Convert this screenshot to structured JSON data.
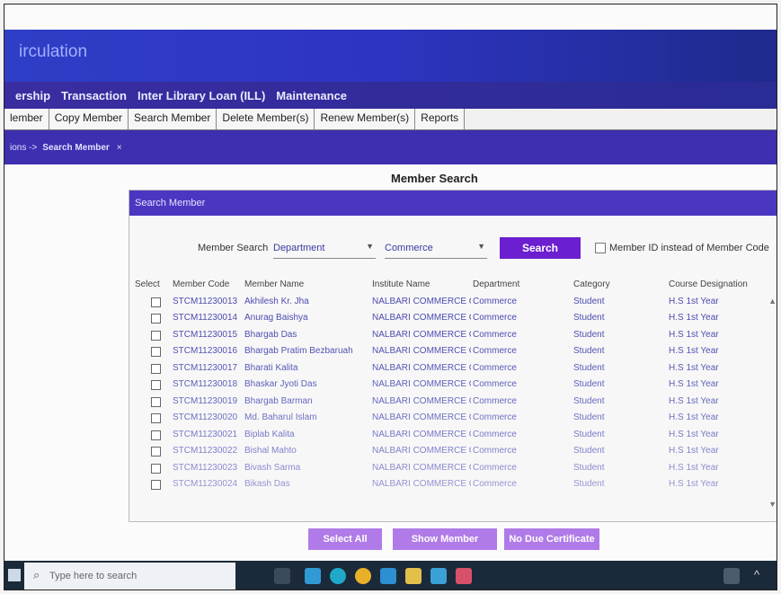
{
  "app": {
    "title": "irculation"
  },
  "menu": [
    "ership",
    "Transaction",
    "Inter Library Loan (ILL)",
    "Maintenance"
  ],
  "subtabs": [
    "lember",
    "Copy Member",
    "Search Member",
    "Delete Member(s)",
    "Renew Member(s)",
    "Reports"
  ],
  "breadcrumb": {
    "path": "ions ->",
    "current": "Search Member",
    "close": "×"
  },
  "page_title": "Member Search",
  "panel": {
    "heading": "Search Member",
    "search_label": "Member Search",
    "search_by": "Department",
    "search_value": "Commerce",
    "search_button": "Search",
    "option_label": "Member ID instead of Member Code"
  },
  "table": {
    "headers": [
      "Select",
      "Member Code",
      "Member Name",
      "Institute Name",
      "Department",
      "Category",
      "Course Designation"
    ],
    "rows": [
      {
        "code": "STCM11230013",
        "name": "Akhilesh Kr. Jha",
        "institute": "NALBARI COMMERCE C",
        "dept": "Commerce",
        "category": "Student",
        "course": "H.S 1st Year"
      },
      {
        "code": "STCM11230014",
        "name": "Anurag Baishya",
        "institute": "NALBARI COMMERCE C",
        "dept": "Commerce",
        "category": "Student",
        "course": "H.S 1st Year"
      },
      {
        "code": "STCM11230015",
        "name": "Bhargab Das",
        "institute": "NALBARI COMMERCE C",
        "dept": "Commerce",
        "category": "Student",
        "course": "H.S 1st Year"
      },
      {
        "code": "STCM11230016",
        "name": "Bhargab Pratim Bezbaruah",
        "institute": "NALBARI COMMERCE C",
        "dept": "Commerce",
        "category": "Student",
        "course": "H.S 1st Year"
      },
      {
        "code": "STCM11230017",
        "name": "Bharati Kalita",
        "institute": "NALBARI COMMERCE C",
        "dept": "Commerce",
        "category": "Student",
        "course": "H.S 1st Year"
      },
      {
        "code": "STCM11230018",
        "name": "Bhaskar Jyoti Das",
        "institute": "NALBARI COMMERCE C",
        "dept": "Commerce",
        "category": "Student",
        "course": "H.S 1st Year"
      },
      {
        "code": "STCM11230019",
        "name": "Bhargab Barman",
        "institute": "NALBARI COMMERCE C",
        "dept": "Commerce",
        "category": "Student",
        "course": "H.S 1st Year"
      },
      {
        "code": "STCM11230020",
        "name": "Md. Baharul Islam",
        "institute": "NALBARI COMMERCE C",
        "dept": "Commerce",
        "category": "Student",
        "course": "H.S 1st Year"
      },
      {
        "code": "STCM11230021",
        "name": "Biplab Kalita",
        "institute": "NALBARI COMMERCE C",
        "dept": "Commerce",
        "category": "Student",
        "course": "H.S 1st Year"
      },
      {
        "code": "STCM11230022",
        "name": "Bishal Mahto",
        "institute": "NALBARI COMMERCE C",
        "dept": "Commerce",
        "category": "Student",
        "course": "H.S 1st Year"
      },
      {
        "code": "STCM11230023",
        "name": "Bivash Sarma",
        "institute": "NALBARI COMMERCE C",
        "dept": "Commerce",
        "category": "Student",
        "course": "H.S 1st Year"
      },
      {
        "code": "STCM11230024",
        "name": "Bikash Das",
        "institute": "NALBARI COMMERCE C",
        "dept": "Commerce",
        "category": "Student",
        "course": "H.S 1st Year"
      }
    ]
  },
  "actions": {
    "select_all": "Select All",
    "show_member": "Show Member",
    "no_due": "No Due Certificate"
  },
  "taskbar": {
    "search_placeholder": "Type here to search"
  },
  "colors": {
    "header": "#2f3ec6",
    "panel_header": "#4a37c1",
    "search_button": "#6b1fd0",
    "action_button": "#b07be8"
  }
}
